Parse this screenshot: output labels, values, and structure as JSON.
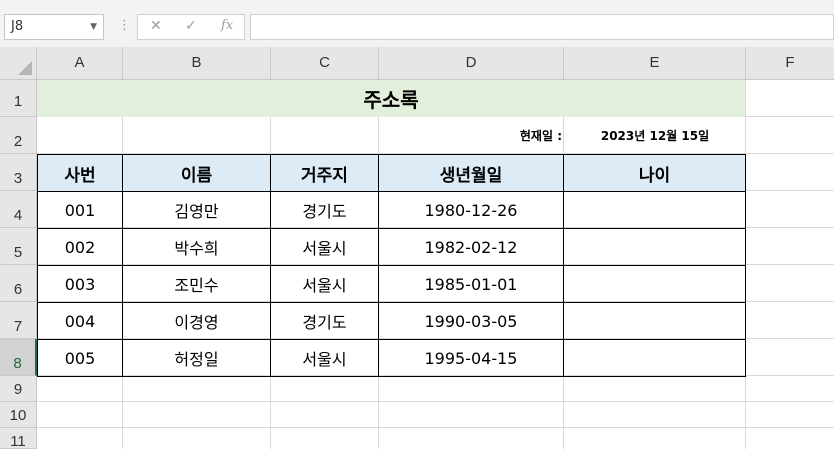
{
  "formula_bar": {
    "name_box": "J8",
    "cancel_glyph": "✕",
    "enter_glyph": "✓",
    "fx_glyph": "fx",
    "formula_value": ""
  },
  "columns": [
    "A",
    "B",
    "C",
    "D",
    "E",
    "F"
  ],
  "rows": [
    "1",
    "2",
    "3",
    "4",
    "5",
    "6",
    "7",
    "8",
    "9",
    "10",
    "11"
  ],
  "selected_cell": "J8",
  "sheet": {
    "title": "주소록",
    "date_label": "현재일 :",
    "date_value": "2023년 12월 15일",
    "headers": [
      "사번",
      "이름",
      "거주지",
      "생년월일",
      "나이"
    ],
    "records": [
      [
        "001",
        "김영만",
        "경기도",
        "1980-12-26",
        ""
      ],
      [
        "002",
        "박수희",
        "서울시",
        "1982-02-12",
        ""
      ],
      [
        "003",
        "조민수",
        "서울시",
        "1985-01-01",
        ""
      ],
      [
        "004",
        "이경영",
        "경기도",
        "1990-03-05",
        ""
      ],
      [
        "005",
        "허정일",
        "서울시",
        "1995-04-15",
        ""
      ]
    ]
  },
  "colors": {
    "title_fill": "#e2efda",
    "header_fill": "#ddebf7",
    "selection": "#1e6c41"
  }
}
